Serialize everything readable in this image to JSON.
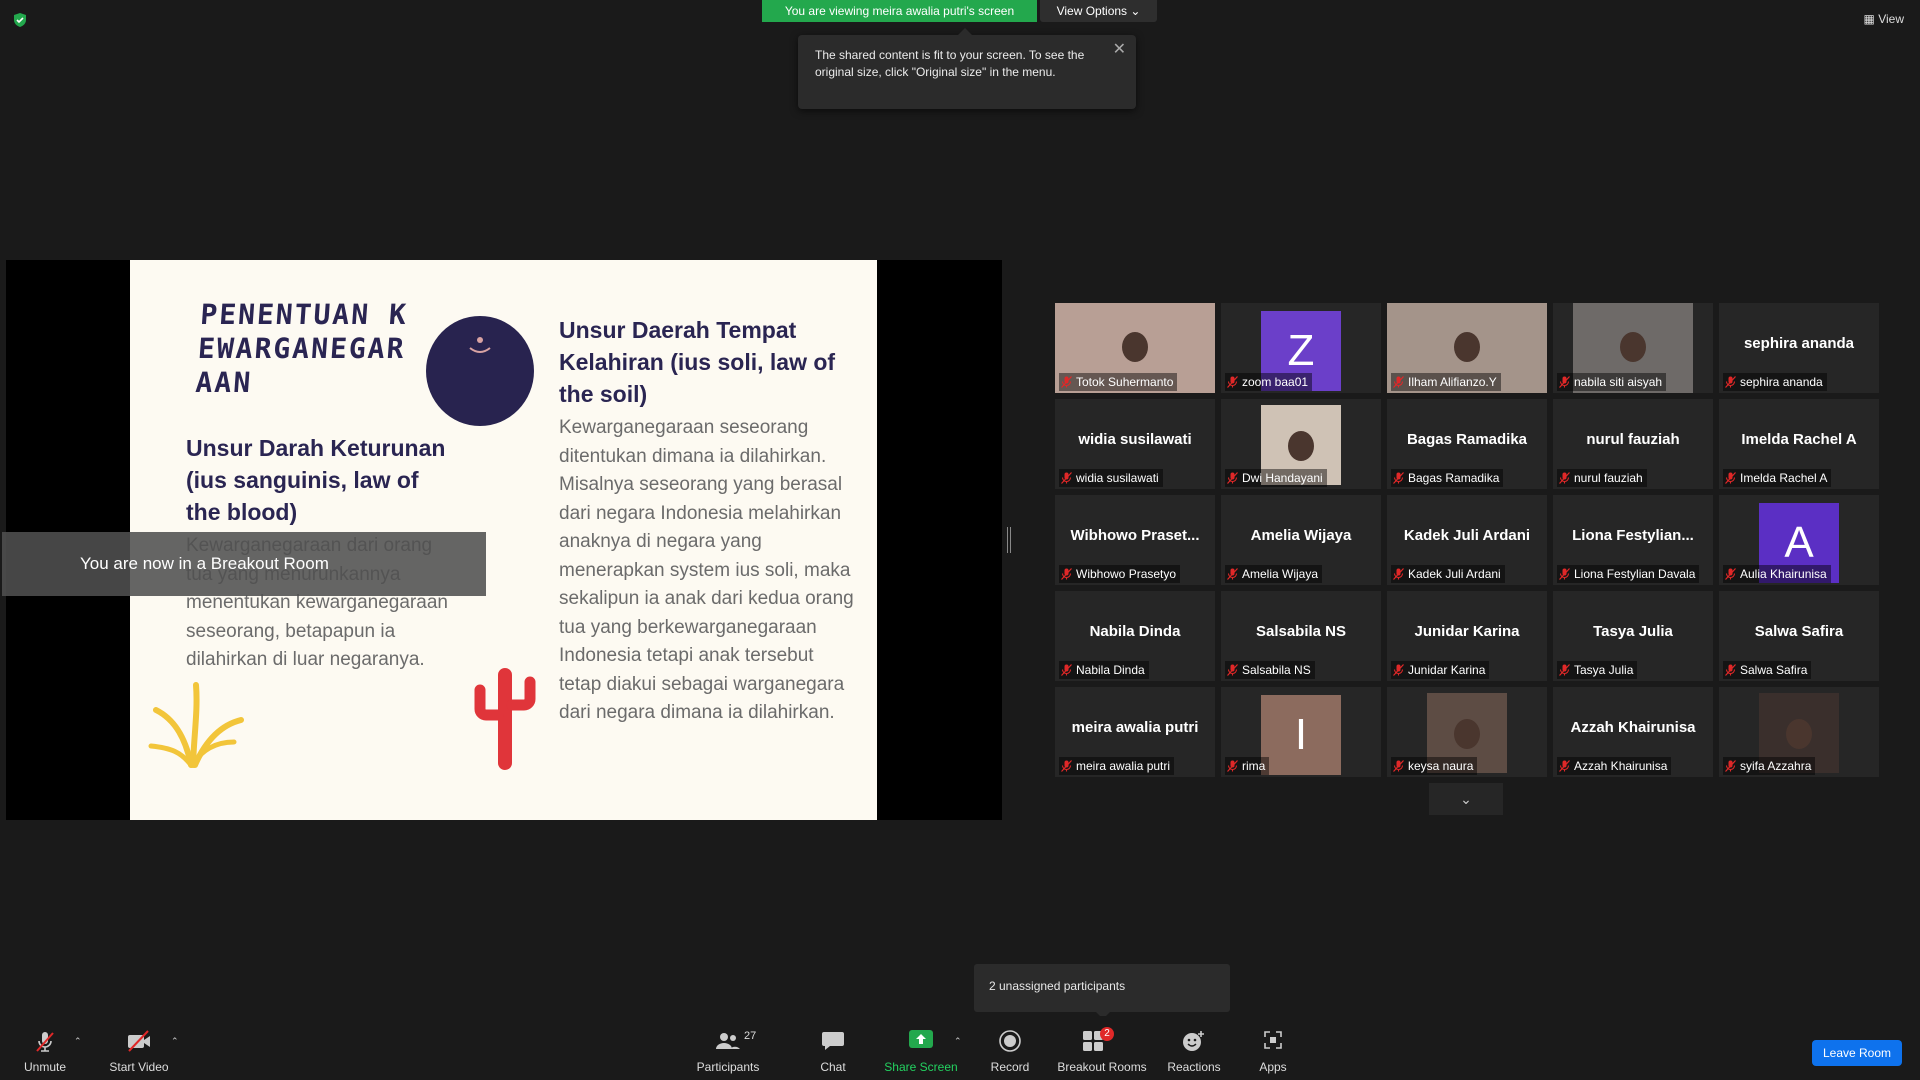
{
  "top": {
    "viewing_banner": "You are viewing meira awalia putri's screen",
    "view_options": "View Options ⌄",
    "tooltip": "The shared content is fit to your screen. To see the original size, click \"Original size\" in the menu.",
    "view_button": "View"
  },
  "slide": {
    "title": "PENENTUAN KEWARGANEGARAAN",
    "left_heading": "Unsur Darah Keturunan (ius sanguinis, law of the blood)",
    "left_body": "Kewarganegaraan dari orang tua yang menurunkannya menentukan kewarganegaraan seseorang, betapapun ia dilahirkan di luar negaranya.",
    "right_heading": "Unsur Daerah Tempat Kelahiran (ius soli, law of the soil)",
    "right_body": "Kewarganegaraan seseorang ditentukan dimana ia dilahirkan. Misalnya seseorang yang berasal dari negara Indonesia melahirkan anaknya di negara yang menerapkan system ius soli, maka sekalipun ia anak dari kedua orang tua yang berkewarganegaraan Indonesia tetapi anak tersebut tetap diakui sebagai warganegara dari negara dimana ia dilahirkan."
  },
  "breakout_toast": "You are now in a Breakout Room",
  "participants": [
    {
      "name": "Totok Suhermanto",
      "kind": "photo"
    },
    {
      "name": "zoom baa01",
      "kind": "letter",
      "letter": "Z",
      "color": "#6b3fc9"
    },
    {
      "name": "Ilham Alifianzo.Y",
      "kind": "photo",
      "active": true
    },
    {
      "name": "nabila siti aisyah",
      "kind": "photo"
    },
    {
      "name": "sephira ananda",
      "display": "sephira ananda",
      "kind": "name"
    },
    {
      "name": "widia susilawati",
      "display": "widia susilawati",
      "kind": "name"
    },
    {
      "name": "Dwi Handayani",
      "kind": "photo"
    },
    {
      "name": "Bagas Ramadika",
      "display": "Bagas Ramadika",
      "kind": "name"
    },
    {
      "name": "nurul fauziah",
      "display": "nurul fauziah",
      "kind": "name"
    },
    {
      "name": "Imelda Rachel A",
      "display": "Imelda Rachel A",
      "kind": "name"
    },
    {
      "name": "Wibhowo Prasetyo",
      "display": "Wibhowo  Praset...",
      "kind": "name"
    },
    {
      "name": "Amelia Wijaya",
      "display": "Amelia Wijaya",
      "kind": "name"
    },
    {
      "name": "Kadek Juli Ardani",
      "display": "Kadek Juli Ardani",
      "kind": "name"
    },
    {
      "name": "Liona Festylian Davala",
      "display": "Liona  Festylian...",
      "kind": "name"
    },
    {
      "name": "Aulia Khairunisa",
      "kind": "letter",
      "letter": "A",
      "color": "#5b2fc4"
    },
    {
      "name": "Nabila Dinda",
      "display": "Nabila Dinda",
      "kind": "name"
    },
    {
      "name": "Salsabila NS",
      "display": "Salsabila NS",
      "kind": "name"
    },
    {
      "name": "Junidar Karina",
      "display": "Junidar Karina",
      "kind": "name"
    },
    {
      "name": "Tasya Julia",
      "display": "Tasya Julia",
      "kind": "name"
    },
    {
      "name": "Salwa Safira",
      "display": "Salwa Safira",
      "kind": "name"
    },
    {
      "name": "meira awalia putri",
      "display": "meira awalia putri",
      "kind": "name"
    },
    {
      "name": "rima",
      "kind": "letter",
      "letter": "I",
      "color": "#8c6b5e"
    },
    {
      "name": "keysa naura",
      "kind": "photo"
    },
    {
      "name": "Azzah Khairunisa",
      "display": "Azzah Khairunisa",
      "kind": "name"
    },
    {
      "name": "syifa Azzahra",
      "kind": "photo"
    }
  ],
  "unassigned": "2 unassigned participants",
  "toolbar": {
    "unmute": "Unmute",
    "start_video": "Start Video",
    "participants": "Participants",
    "participants_count": "27",
    "chat": "Chat",
    "share_screen": "Share Screen",
    "record": "Record",
    "breakout_rooms": "Breakout Rooms",
    "breakout_badge": "2",
    "reactions": "Reactions",
    "apps": "Apps",
    "leave": "Leave Room"
  },
  "colors": {
    "banner_green": "#23a84d",
    "active_speaker": "#d5f04a",
    "leave_blue": "#0e72ed",
    "mute_red": "#e02828",
    "slide_navy": "#2a2552"
  }
}
